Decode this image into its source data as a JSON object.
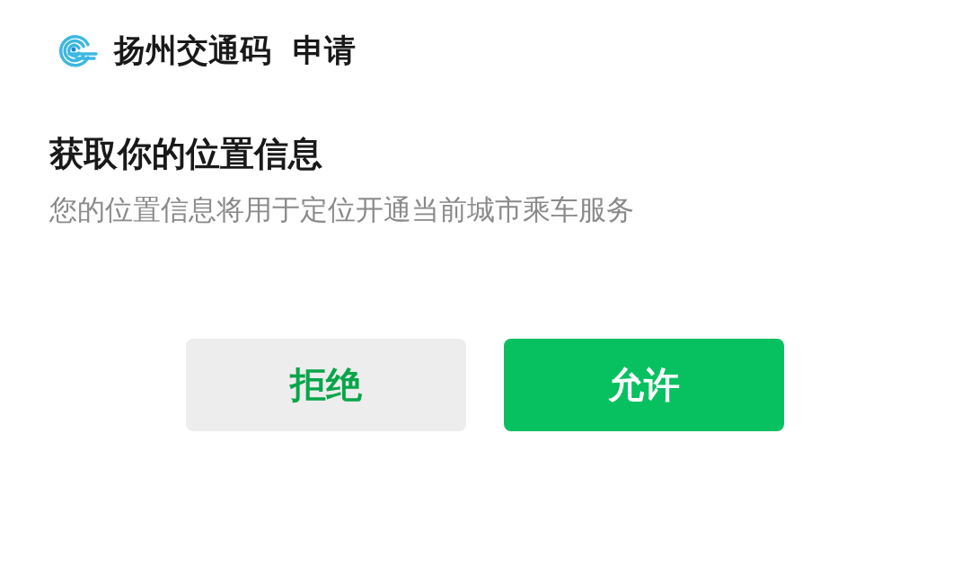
{
  "header": {
    "app_name": "扬州交通码",
    "action": "申请"
  },
  "title": "获取你的位置信息",
  "description": "您的位置信息将用于定位开通当前城市乘车服务",
  "buttons": [
    {
      "label": "拒绝",
      "kind": "secondary"
    },
    {
      "label": "允许",
      "kind": "primary"
    }
  ]
}
